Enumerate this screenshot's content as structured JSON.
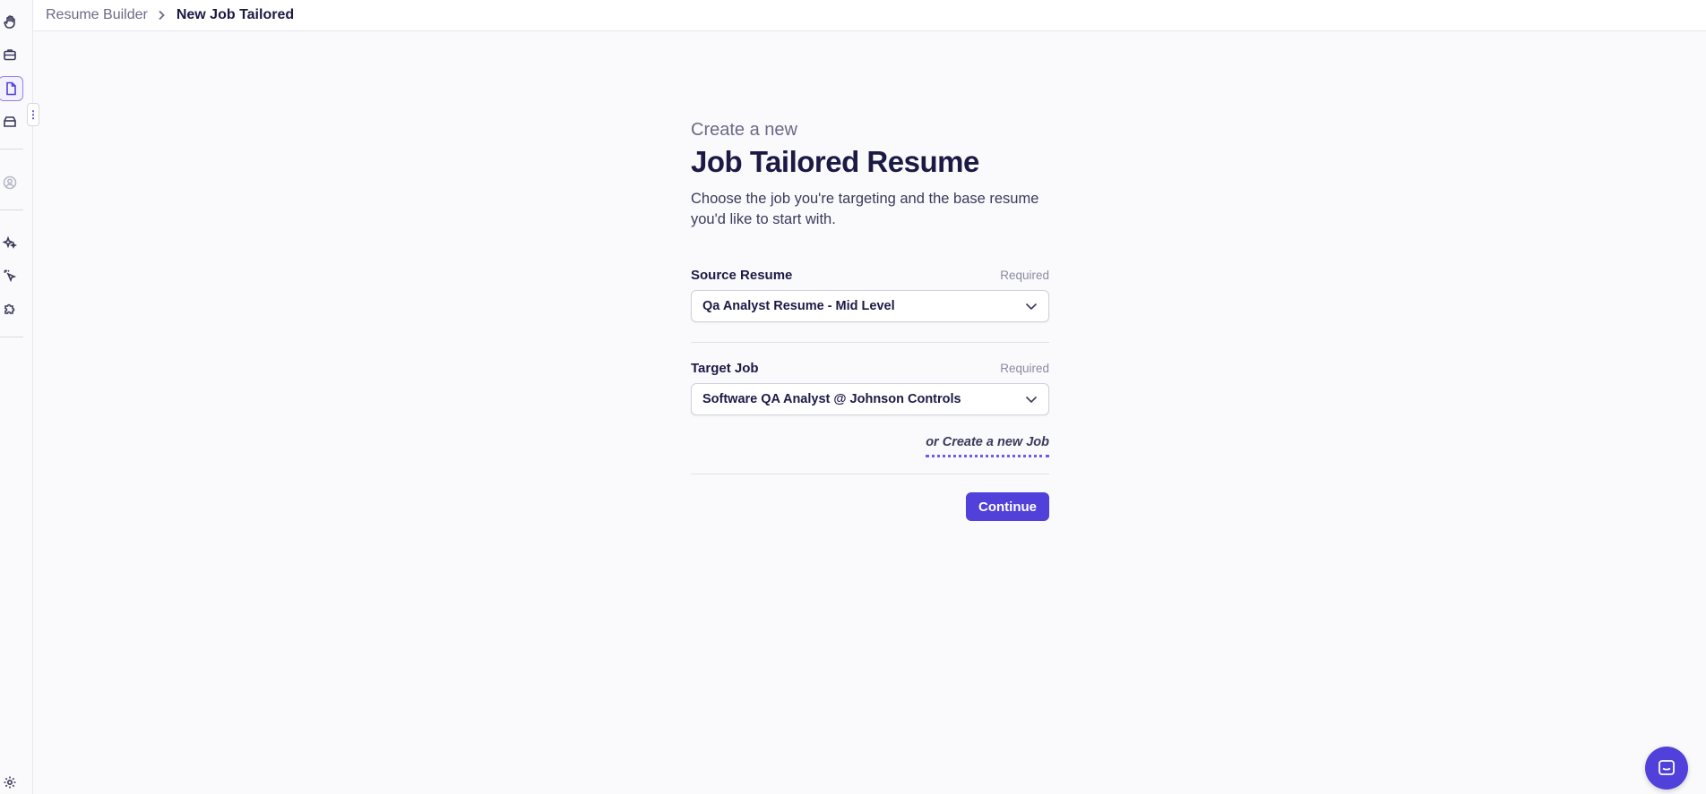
{
  "sidebar": {
    "icons": [
      "hand-wave-icon",
      "briefcase-icon",
      "document-icon",
      "archive-icon",
      "avatar-icon",
      "sparkle-icon",
      "cursor-click-icon",
      "puzzle-icon",
      "gear-icon"
    ],
    "active": "document-icon",
    "toggle_glyph": "⋮"
  },
  "header": {
    "crumb_parent": "Resume Builder",
    "crumb_current": "New Job Tailored"
  },
  "form": {
    "eyebrow": "Create a new",
    "title": "Job Tailored Resume",
    "description": "Choose the job you're targeting and the base resume you'd like to start with.",
    "source": {
      "label": "Source Resume",
      "required": "Required",
      "value": "Qa Analyst Resume - Mid Level"
    },
    "target": {
      "label": "Target Job",
      "required": "Required",
      "value": "Software QA Analyst @ Johnson Controls"
    },
    "create_link": "or Create a new Job",
    "continue_label": "Continue"
  },
  "colors": {
    "accent": "#5140d9",
    "background": "#fafafc",
    "text": "#1c1a45"
  }
}
